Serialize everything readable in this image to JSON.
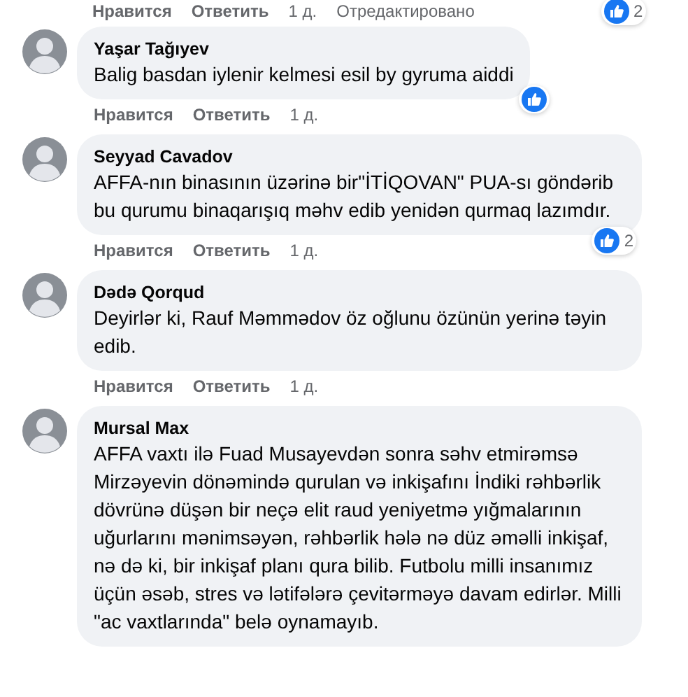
{
  "top_actions": {
    "like": "Нравится",
    "reply": "Ответить",
    "time": "1 д.",
    "edited": "Отредактировано",
    "reacted": true,
    "reaction_count": "2"
  },
  "comments": [
    {
      "author": "Yaşar Tağıyev",
      "text": "Balig basdan iylenir kelmesi esil by gyruma aiddi",
      "like": "Нравится",
      "reply": "Ответить",
      "time": "1 д.",
      "reacted": true
    },
    {
      "author": "Seyyad Cavadov",
      "text": "AFFA-nın binasının üzərinə bir\"İTİQOVAN\" PUA-sı göndərib bu qurumu binaqarışıq məhv edib yenidən qurmaq lazımdır.",
      "like": "Нравится",
      "reply": "Ответить",
      "time": "1 д.",
      "reacted": true,
      "reaction_count": "2"
    },
    {
      "author": "Dədə Qorqud",
      "text": "Deyirlər ki, Rauf Məmmədov öz oğlunu özünün yerinə təyin edib.",
      "like": "Нравится",
      "reply": "Ответить",
      "time": "1 д.",
      "reacted": false
    },
    {
      "author": "Mursal Max",
      "text": "AFFA vaxtı ilə Fuad Musayevdən sonra səhv etmirəmsə Mirzəyevin dönəmində qurulan və inkişafını İndiki rəhbərlik dövrünə düşən bir neçə elit raud yeniyetmə yığmalarının uğurlarını mənimsəyən, rəhbərlik hələ nə düz əməlli inkişaf, nə də ki, bir inkişaf planı qura bilib. Futbolu milli insanımız üçün əsəb, stres və lətifələrə çevitərməyə davam edirlər. Milli \"ac vaxtlarında\" belə oynamayıb.",
      "reacted": false
    }
  ]
}
